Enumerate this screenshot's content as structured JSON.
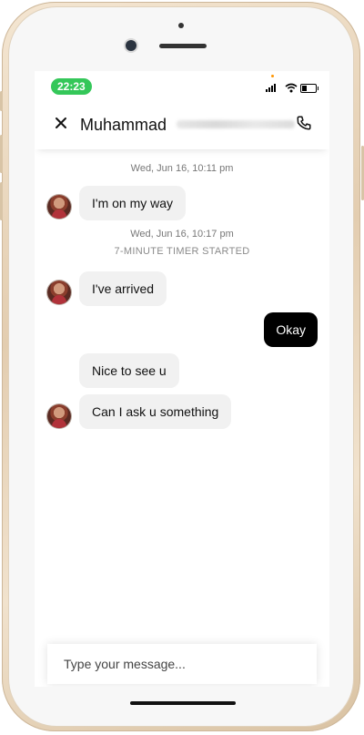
{
  "status_bar": {
    "time": "22:23"
  },
  "header": {
    "contact_name": "Muhammad"
  },
  "messages": {
    "timestamp_1": "Wed, Jun 16, 10:11 pm",
    "msg_1": "I'm on my way",
    "timestamp_2": "Wed, Jun 16, 10:17 pm",
    "timer_notice": "7-MINUTE TIMER STARTED",
    "msg_2": "I've arrived",
    "msg_3_out": "Okay",
    "msg_4": "Nice to see u",
    "msg_5": "Can I ask u something"
  },
  "composer": {
    "placeholder": "Type your message..."
  },
  "icons": {
    "close": "close-icon",
    "call": "phone-icon",
    "signal": "cellular-signal-icon",
    "wifi": "wifi-icon",
    "battery": "battery-icon"
  },
  "colors": {
    "time_pill": "#34c759",
    "outgoing_bubble": "#000000",
    "incoming_bubble": "#f1f1f1"
  }
}
